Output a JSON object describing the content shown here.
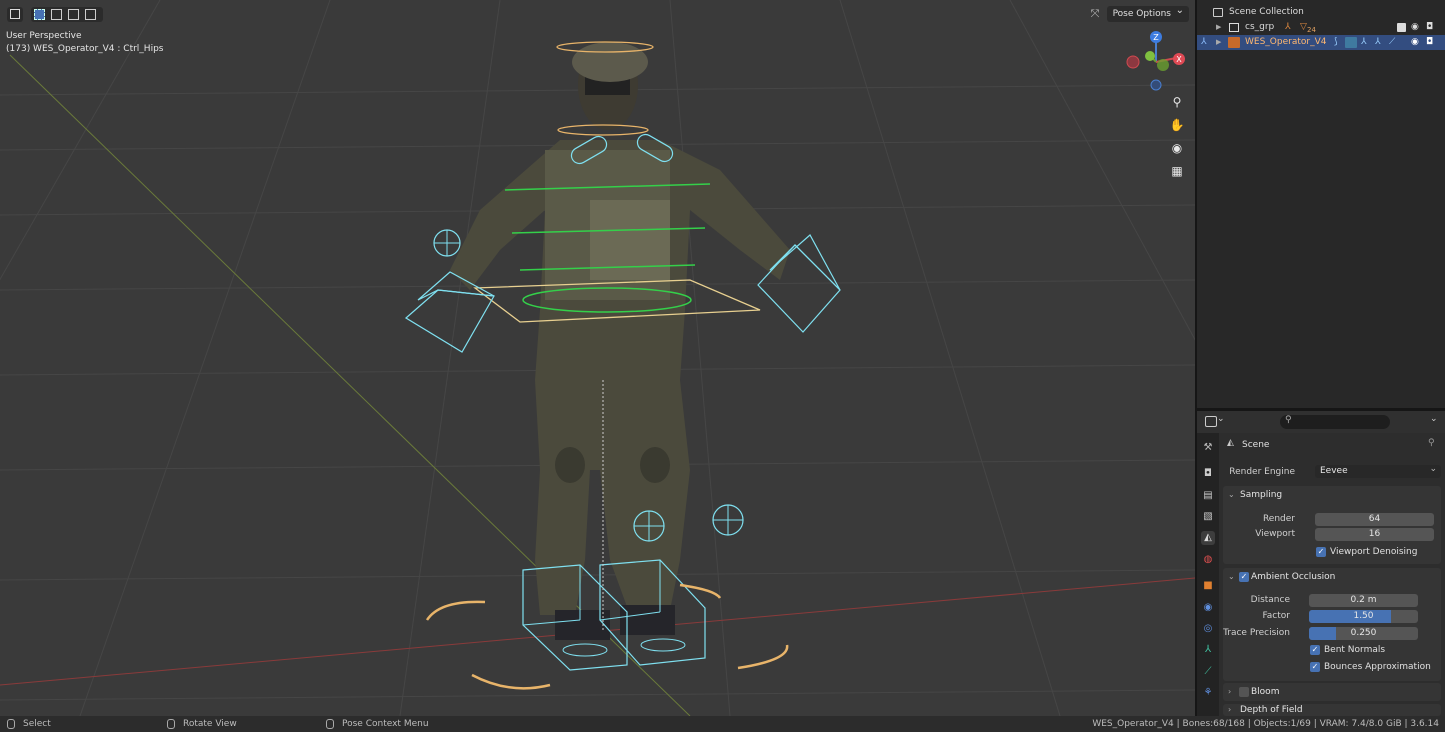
{
  "viewport": {
    "view_name": "User Perspective",
    "active_object": "(173) WES_Operator_V4 : Ctrl_Hips",
    "pose_options_label": "Pose Options",
    "x_toggle": "X"
  },
  "outliner": {
    "scene_collection": "Scene Collection",
    "rows": [
      {
        "name": "cs_grp",
        "badge": "24"
      },
      {
        "name": "WES_Operator_V4"
      }
    ]
  },
  "properties": {
    "context_title": "Scene",
    "render_engine_label": "Render Engine",
    "render_engine_value": "Eevee",
    "sampling": {
      "title": "Sampling",
      "render_label": "Render",
      "render_value": "64",
      "viewport_label": "Viewport",
      "viewport_value": "16",
      "denoise_label": "Viewport Denoising"
    },
    "ambient_occlusion": {
      "title": "Ambient Occlusion",
      "distance_label": "Distance",
      "distance_value": "0.2 m",
      "factor_label": "Factor",
      "factor_value": "1.50",
      "factor_fill": 0.75,
      "trace_label": "Trace Precision",
      "trace_value": "0.250",
      "trace_fill": 0.25,
      "bent_normals_label": "Bent Normals",
      "bounces_label": "Bounces Approximation"
    },
    "bloom_label": "Bloom",
    "dof_label": "Depth of Field"
  },
  "statusbar": {
    "select": "Select",
    "rotate": "Rotate View",
    "context_menu": "Pose Context Menu",
    "stats": "WES_Operator_V4 | Bones:68/168 | Objects:1/69 | VRAM: 7.4/8.0 GiB | 3.6.14"
  },
  "colors": {
    "accent": "#4772b3",
    "selected_row": "#334d80",
    "bone_green": "#34d04a",
    "bone_orange": "#e8b46a",
    "bone_cyan": "#7fe0f0"
  }
}
